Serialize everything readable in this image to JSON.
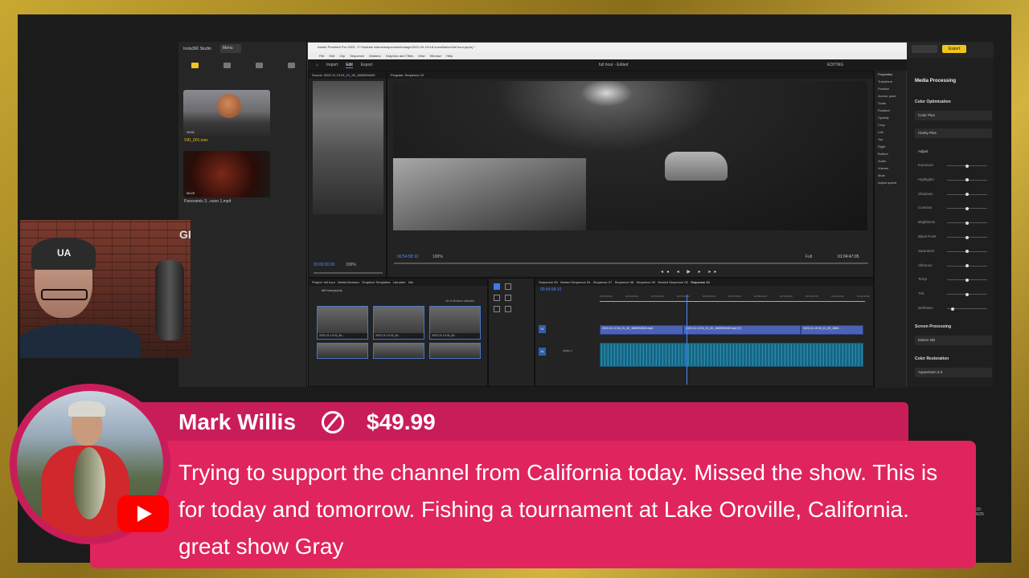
{
  "insta360": {
    "title": "Insta360 Studio",
    "menu_label": "Menu",
    "clips": [
      {
        "duration": "10:01",
        "name": "VID_001.insv"
      },
      {
        "duration": "06:29",
        "name": "Panoramic 3...rsion 1.mp4"
      }
    ]
  },
  "premiere": {
    "title": "Adobe Premiere Pro 2023 - F:\\Youtube videos\\sequences\\footage\\2022-09-19 full surveillance\\full hour.prproj *",
    "menu": [
      "File",
      "Edit",
      "Clip",
      "Sequence",
      "Markers",
      "Graphics and Titles",
      "View",
      "Window",
      "Help"
    ],
    "workspace_tabs": [
      "Import",
      "Edit",
      "Export"
    ],
    "project_title": "full hour - Edited",
    "editing_label": "EDITING",
    "source_tab": "Source: 2022-11-13 04_21_40_1669094049",
    "program_tab": "Program: Sequence 10",
    "source_timecode": "00:00:00:00",
    "source_zoom": "100%",
    "program_timecode": "00:54:58:10",
    "program_zoom": "100%",
    "program_quality": "Full",
    "program_duration": "01:04:47:05",
    "project_tabs": [
      "Project: full hour",
      "Media Browser",
      "Graphics Templates",
      "Libraries",
      "Info"
    ],
    "project_name": "full hour.prproj",
    "items_selected": "15 of 36 items selected",
    "project_items": [
      {
        "name": "2022-11-13 03_40...",
        "dur": "3:36:17"
      },
      {
        "name": "2022-11-13 03_40...",
        "dur": "5:00:01"
      },
      {
        "name": "2022-11-13 04_40...",
        "dur": "4:59:11"
      }
    ],
    "sequence_tabs": [
      "Sequence 06",
      "Nested Sequence 04",
      "Sequence 07",
      "Sequence 08",
      "Sequence 09",
      "Nested Sequence 05",
      "Sequence 10"
    ],
    "timeline_timecode": "00:54:58:10",
    "ruler": [
      "00:52:00:00",
      "00:53:00:00",
      "00:54:00:00",
      "00:55:00:00",
      "00:56:00:00",
      "00:57:00:00",
      "00:58:00:00",
      "00:59:00:00",
      "01:00:00:00",
      "01:01:00:00",
      "01:02:00:00"
    ],
    "video_clips": [
      "2022-11-13 04_21_40_1669094049.mp4",
      "2022-11-13 04_21_40_1669094049.mp4 [V]",
      "2022-11-13 05_21_00_1669..."
    ],
    "tracks": {
      "v1": "V1",
      "a1": "A1",
      "audio_label": "Audio 1"
    },
    "properties": {
      "title": "Properties",
      "items": [
        "Transform",
        "Position",
        "Anchor point",
        "Scale",
        "Rotation",
        "Opacity",
        "Crop",
        "Left",
        "Top",
        "Right",
        "Bottom",
        "Audio",
        "Volume",
        "Mute",
        "Adjust speed"
      ]
    }
  },
  "media_panel": {
    "export_label": "Export",
    "title": "Media Processing",
    "color_opt": "Color Optimization",
    "color_plus": "Color Plus",
    "clarity_plus": "Clarity Plus",
    "adjust": "Adjust",
    "sliders": [
      {
        "label": "Exposure",
        "value": 0.5
      },
      {
        "label": "Highlights",
        "value": 0.5
      },
      {
        "label": "Shadows",
        "value": 0.5
      },
      {
        "label": "Contrast",
        "value": 0.5
      },
      {
        "label": "Brightness",
        "value": 0.5
      },
      {
        "label": "Black Point",
        "value": 0.5
      },
      {
        "label": "Saturation",
        "value": 0.5
      },
      {
        "label": "Vibrance",
        "value": 0.5
      },
      {
        "label": "Temp",
        "value": 0.5
      },
      {
        "label": "Tint",
        "value": 0.5
      },
      {
        "label": "Definition",
        "value": 0.1
      }
    ],
    "screen_processing": "Screen Processing",
    "motion_nd": "Motion ND",
    "color_restoration": "Color Restoration",
    "aquavision": "AquaVision 3.0"
  },
  "webcam": {
    "cap_logo": "UA",
    "sign": "GR"
  },
  "superchat": {
    "name": "Mark Willis",
    "amount": "$49.99",
    "message": "Trying to support the channel from California today. Missed the show. This is for today and tomorrow. Fishing a tournament at Lake Oroville, California.  great show Gray"
  },
  "taskbar_clock": "10:\n6/25",
  "colors": {
    "superchat": "#e0245e",
    "superchat_header": "#c91d5a",
    "frame_gold": "#c9a832",
    "insta_accent": "#f2c31d"
  }
}
